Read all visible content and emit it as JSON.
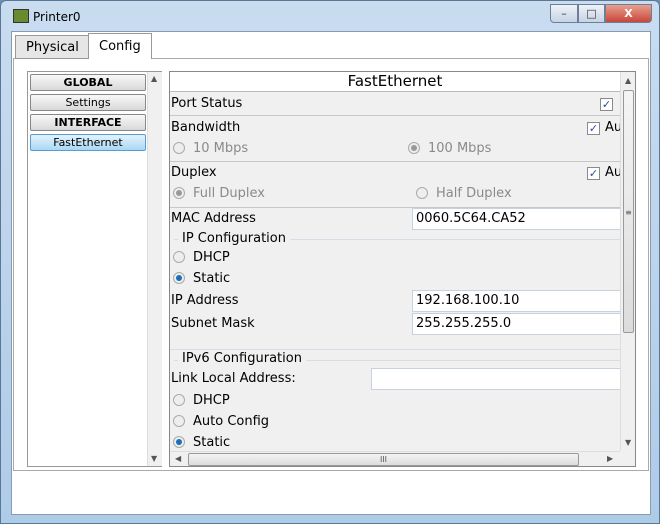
{
  "window": {
    "title": "Printer0",
    "minimize": "–",
    "maximize": "□",
    "close": "X",
    "app_icon": "printer-icon"
  },
  "tabs": [
    {
      "label": "Physical",
      "active": false
    },
    {
      "label": "Config",
      "active": true
    }
  ],
  "sidebar": {
    "items": [
      {
        "label": "GLOBAL",
        "type": "header"
      },
      {
        "label": "Settings"
      },
      {
        "label": "INTERFACE",
        "type": "header"
      },
      {
        "label": "FastEthernet",
        "selected": true
      }
    ]
  },
  "main": {
    "title": "FastEthernet",
    "port_status": {
      "label": "Port Status",
      "checked": true
    },
    "bandwidth": {
      "label": "Bandwidth",
      "auto_label": "Au",
      "auto": true,
      "opt1": "10 Mbps",
      "opt2": "100 Mbps",
      "selected": "100 Mbps"
    },
    "duplex": {
      "label": "Duplex",
      "auto_label": "Au",
      "auto": true,
      "opt1": "Full Duplex",
      "opt2": "Half Duplex",
      "selected": "Full Duplex"
    },
    "mac": {
      "label": "MAC Address",
      "value": "0060.5C64.CA52"
    },
    "ipv4": {
      "group": "IP Configuration",
      "dhcp": "DHCP",
      "static": "Static",
      "selected": "Static",
      "ip_label": "IP Address",
      "ip": "192.168.100.10",
      "mask_label": "Subnet Mask",
      "mask": "255.255.255.0"
    },
    "ipv6": {
      "group": "IPv6 Configuration",
      "link_local_label": "Link Local Address:",
      "link_local": "",
      "dhcp": "DHCP",
      "auto": "Auto Config",
      "static": "Static",
      "selected": "Static"
    },
    "hscroll_grip": "III"
  },
  "colors": {
    "selected_item": "#a9d8f5",
    "radio_on": "#1a6fb8",
    "close_button": "#c9463b"
  }
}
